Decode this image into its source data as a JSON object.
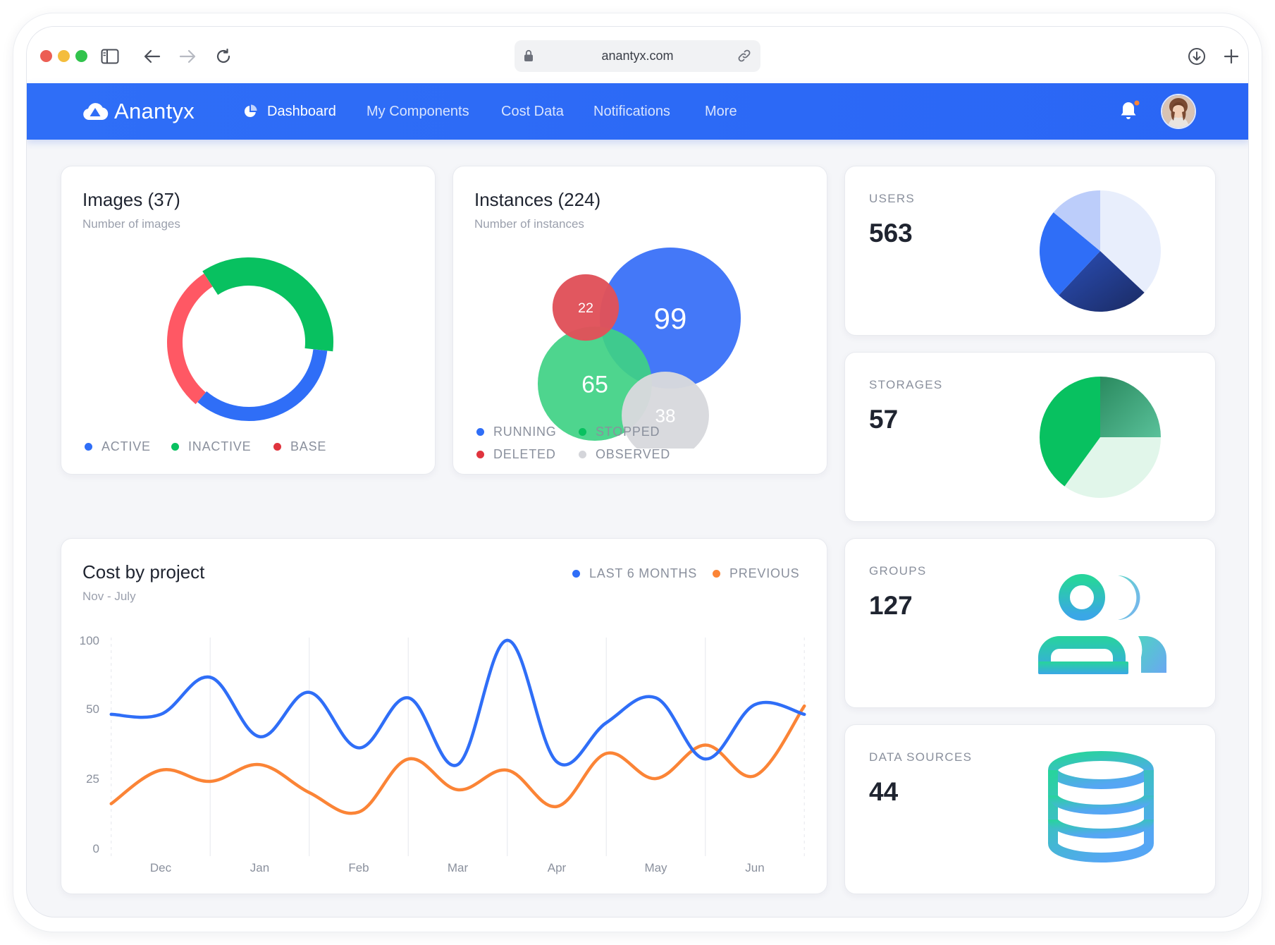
{
  "browser": {
    "url": "anantyx.com"
  },
  "nav": {
    "brand": "Anantyx",
    "items": [
      {
        "label": "Dashboard",
        "active": true
      },
      {
        "label": "My Components",
        "active": false
      },
      {
        "label": "Cost Data",
        "active": false
      },
      {
        "label": "Notifications",
        "active": false
      },
      {
        "label": "More",
        "active": false
      }
    ]
  },
  "colors": {
    "blue": "#2f6ef7",
    "green": "#08c160",
    "red": "#ff5864",
    "orange": "#fb8436",
    "gray": "#d4d5da"
  },
  "images_card": {
    "title": "Images (37)",
    "subtitle": "Number of images",
    "chart_data": {
      "type": "pie",
      "slices": [
        {
          "name": "ACTIVE",
          "value": 0.345,
          "color": "#2f6ef7"
        },
        {
          "name": "INACTIVE",
          "value": 0.36,
          "color": "#08c160"
        },
        {
          "name": "BASE",
          "value": 0.295,
          "color": "#ff5864"
        }
      ]
    },
    "legend": [
      "ACTIVE",
      "INACTIVE",
      "BASE"
    ]
  },
  "instances_card": {
    "title": "Instances (224)",
    "subtitle": "Number of instances",
    "chart_data": {
      "type": "scatter",
      "bubbles": [
        {
          "name": "RUNNING",
          "value": 99,
          "color": "#3e74f8"
        },
        {
          "name": "STOPPED",
          "value": 65,
          "color": "#3fd184"
        },
        {
          "name": "OBSERVED",
          "value": 38,
          "color": "#d8d9dd"
        },
        {
          "name": "DELETED",
          "value": 22,
          "color": "#e0525a"
        }
      ]
    },
    "legend": [
      "RUNNING",
      "STOPPED",
      "DELETED",
      "OBSERVED"
    ]
  },
  "stats": {
    "users": {
      "label": "USERS",
      "value": "563",
      "chart_data": {
        "type": "pie",
        "values": [
          0.37,
          0.25,
          0.24,
          0.14
        ]
      }
    },
    "storages": {
      "label": "STORAGES",
      "value": "57",
      "chart_data": {
        "type": "pie",
        "values": [
          0.25,
          0.35,
          0.4
        ]
      }
    },
    "groups": {
      "label": "GROUPS",
      "value": "127",
      "icon": "users-group-icon"
    },
    "data_sources": {
      "label": "DATA SOURCES",
      "value": "44",
      "icon": "database-icon"
    }
  },
  "cost_card": {
    "title": "Cost by project",
    "subtitle": "Nov - July",
    "chart_data": {
      "type": "line",
      "categories": [
        "Dec",
        "Jan",
        "Feb",
        "Mar",
        "Apr",
        "May",
        "Jun"
      ],
      "y_ticks": [
        "100",
        "50",
        "25",
        "0"
      ],
      "ylim": [
        0,
        100
      ],
      "x": [
        -0.5,
        0,
        0.5,
        1,
        1.5,
        2,
        2.5,
        3,
        3.5,
        4,
        4.5,
        5,
        5.5,
        6,
        6.5
      ],
      "series": [
        {
          "name": "LAST 6 MONTHS",
          "color": "#2f6ef7",
          "values": [
            48,
            48,
            73,
            40,
            62,
            36,
            58,
            30,
            100,
            31,
            45,
            58,
            32,
            53,
            48
          ]
        },
        {
          "name": "PREVIOUS",
          "color": "#fb8436",
          "values": [
            16,
            28,
            24,
            30,
            20,
            13,
            32,
            21,
            28,
            15,
            34,
            25,
            37,
            26,
            52
          ]
        }
      ]
    }
  }
}
